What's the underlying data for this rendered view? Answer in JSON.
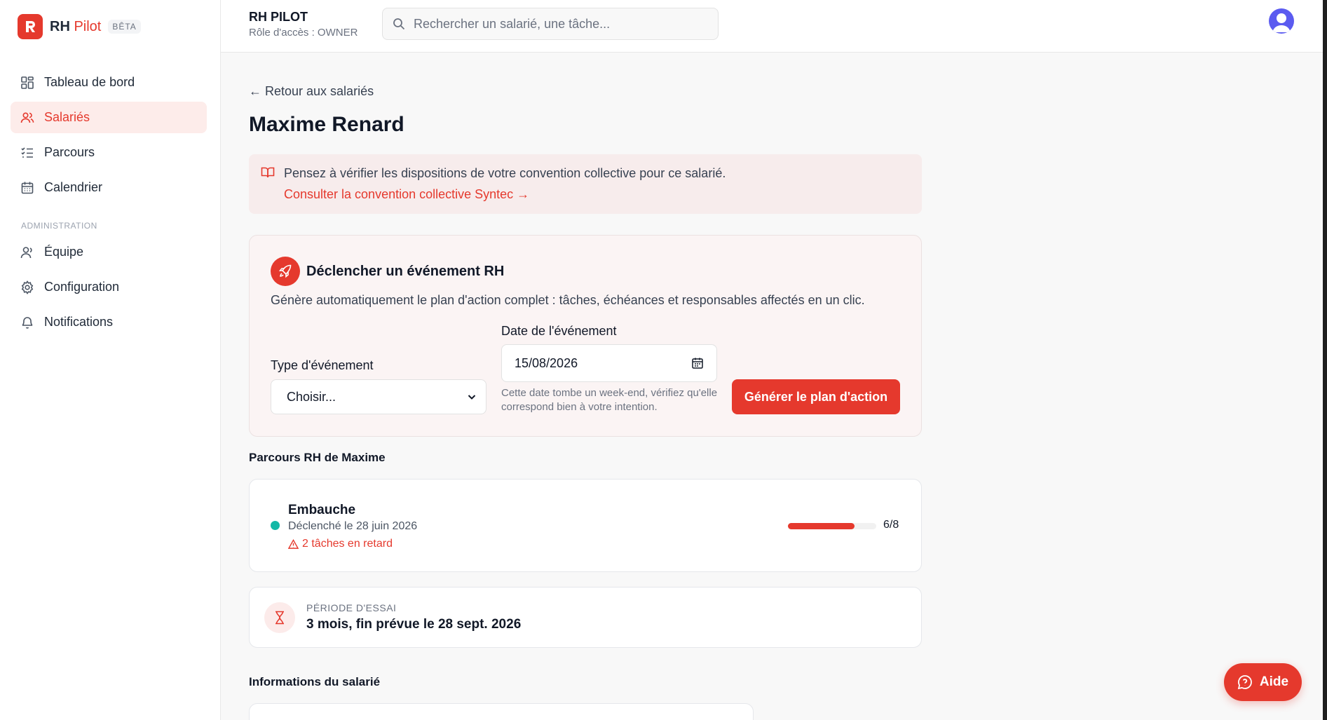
{
  "colors": {
    "accent": "#e5392d",
    "success": "#14b8a6"
  },
  "brand": {
    "name_main": "RH",
    "name_accent": "Pilot",
    "badge": "BÊTA"
  },
  "sidebar": {
    "items": [
      {
        "label": "Tableau de bord",
        "icon": "dashboard-icon"
      },
      {
        "label": "Salariés",
        "icon": "users-icon",
        "active": true
      },
      {
        "label": "Parcours",
        "icon": "checklist-icon"
      },
      {
        "label": "Calendrier",
        "icon": "calendar-icon"
      }
    ],
    "admin_section": "ADMINISTRATION",
    "admin_items": [
      {
        "label": "Équipe",
        "icon": "user-icon"
      },
      {
        "label": "Configuration",
        "icon": "gear-icon"
      },
      {
        "label": "Notifications",
        "icon": "bell-icon"
      }
    ]
  },
  "header": {
    "app_title": "RH PILOT",
    "role": "Rôle d'accès : OWNER",
    "search_placeholder": "Rechercher un salarié, une tâche..."
  },
  "main": {
    "back_link": "← Retour aux salariés",
    "employee_name": "Maxime Renard",
    "notice": {
      "text": "Pensez à vérifier les dispositions de votre convention collective pour ce salarié.",
      "link": "Consulter la convention collective Syntec →"
    },
    "event": {
      "title": "Déclencher un événement RH",
      "description": "Génère automatiquement le plan d'action complet : tâches, échéances et responsables affectés en un clic.",
      "type_label": "Type d'événement",
      "type_value": "Choisir...",
      "date_label": "Date de l'événement",
      "date_value": "15/08/2026",
      "date_warning": "Cette date tombe un week-end, vérifiez qu'elle correspond bien à votre intention.",
      "generate_label": "Générer le plan d'action"
    },
    "journeys_title": "Parcours RH de Maxime",
    "journey": {
      "name": "Embauche",
      "date": "Déclenché le 28 juin 2026",
      "late": "2 tâches en retard",
      "progress_done": 6,
      "progress_total": 8,
      "progress_text": "6/8"
    },
    "trial": {
      "label": "PÉRIODE D'ESSAI",
      "value": "3 mois, fin prévue le 28 sept. 2026"
    },
    "info_title": "Informations du salarié"
  },
  "help": {
    "label": "Aide"
  }
}
